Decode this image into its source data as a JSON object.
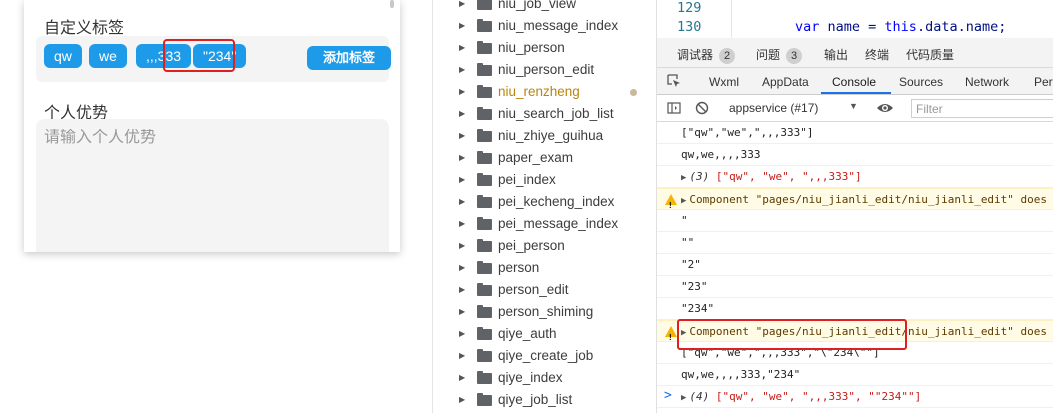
{
  "simulator": {
    "custom_tags_title": "自定义标签",
    "tags": [
      "qw",
      "we",
      ",,,333",
      "\"234\""
    ],
    "add_tag_label": "添加标签",
    "advantages_title": "个人优势",
    "advantages_placeholder": "请输入个人优势"
  },
  "file_tree": {
    "items": [
      {
        "label": "niu_job_view"
      },
      {
        "label": "niu_message_index"
      },
      {
        "label": "niu_person"
      },
      {
        "label": "niu_person_edit"
      },
      {
        "label": "niu_renzheng",
        "modified": true
      },
      {
        "label": "niu_search_job_list"
      },
      {
        "label": "niu_zhiye_guihua"
      },
      {
        "label": "paper_exam"
      },
      {
        "label": "pei_index"
      },
      {
        "label": "pei_kecheng_index"
      },
      {
        "label": "pei_message_index"
      },
      {
        "label": "pei_person"
      },
      {
        "label": "person"
      },
      {
        "label": "person_edit"
      },
      {
        "label": "person_shiming"
      },
      {
        "label": "qiye_auth"
      },
      {
        "label": "qiye_create_job"
      },
      {
        "label": "qiye_index"
      },
      {
        "label": "qiye_job_list"
      }
    ]
  },
  "editor": {
    "line1_number": "129",
    "line2_number": "130",
    "line2_keyword": "var",
    "line2_mid": " name = ",
    "line2_this": "this",
    "line2_rest": ".data.name;"
  },
  "devtools": {
    "top_tabs": {
      "debugger": "调试器",
      "debugger_count": "2",
      "issues": "问题",
      "issues_count": "3",
      "output": "输出",
      "terminal": "终端",
      "code_quality": "代码质量"
    },
    "tabs": [
      "Wxml",
      "AppData",
      "Console",
      "Sources",
      "Network",
      "Perf"
    ],
    "context_select": "appservice (#17)",
    "filter_placeholder": "Filter",
    "console": {
      "l1": "[\"qw\",\"we\",\",,,333\"]",
      "l2": "qw,we,,,,333",
      "l3_count": "(3)",
      "l3_a": "[\"qw\", \"we\", \",,,333\"]",
      "l4": "Component \"pages/niu_jianli_edit/niu_jianli_edit\" does",
      "l5": "\"",
      "l6": "\"\"",
      "l7": "\"2\"",
      "l8": "\"23\"",
      "l9": "\"234\"",
      "l10": "Component \"pages/niu_jianli_edit/niu_jianli_edit\" does",
      "l11": "[\"qw\",\"we\",\",,,333\",\"\\\"234\\\"\"]",
      "l12": "qw,we,,,,333,\"234\"",
      "l13_count": "(4)",
      "l13_a": "[\"qw\", \"we\", \",,,333\", \"\"234\"\"]",
      "prompt": ">"
    }
  }
}
